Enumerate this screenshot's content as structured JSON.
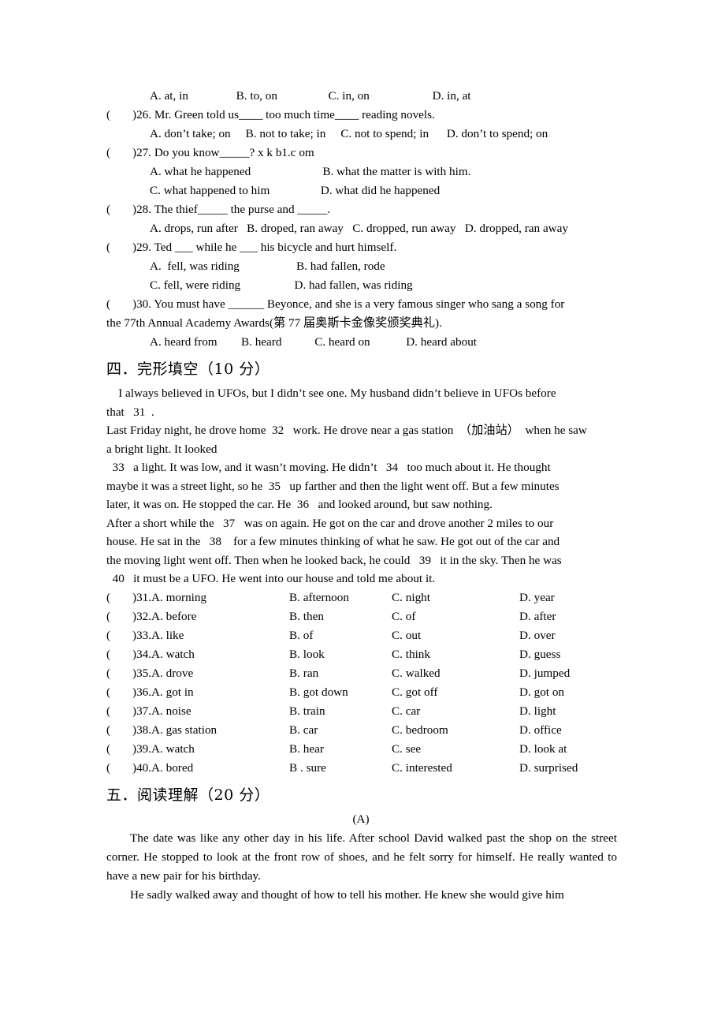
{
  "document": {
    "kind": "english-exam-paper-page"
  },
  "grammar_section": {
    "q25_options_line": "A. at, in                B. to, on                 C. in, on                     D. in, at",
    "questions": [
      {
        "marker_open": "(",
        "marker_close": ")",
        "stem": "26. Mr. Green told us____ too much time____ reading novels.",
        "options_lines": [
          "A. don’t take; on     B. not to take; in     C. not to spend; in      D. don’t to spend; on"
        ]
      },
      {
        "marker_open": "(",
        "marker_close": ")",
        "stem": "27. Do you know_____? x k b1.c om",
        "options_lines": [
          "A. what he happened                        B. what the matter is with him.",
          "C. what happened to him                 D. what did he happened"
        ]
      },
      {
        "marker_open": "(",
        "marker_close": ")",
        "stem": "28. The thief_____ the purse and _____.",
        "options_lines": [
          "A. drops, run after   B. droped, ran away   C. dropped, run away   D. dropped, ran away"
        ]
      },
      {
        "marker_open": "(",
        "marker_close": ")",
        "stem": "29. Ted ___ while he ___ his bicycle and hurt himself.",
        "options_lines": [
          "A.  fell, was riding                   B. had fallen, rode",
          "C. fell, were riding                  D. had fallen, was riding"
        ]
      },
      {
        "marker_open": "(",
        "marker_close": ")",
        "stem_line1": "30. You must have ______ Beyonce, and she is a very famous singer who sang a song for",
        "stem_line2": "the 77th Annual Academy Awards(第 77 届奥斯卡金像奖颁奖典礼).",
        "options_lines": [
          "A. heard from        B. heard           C. heard on            D. heard about"
        ]
      }
    ]
  },
  "cloze_section": {
    "heading": "四．完形填空（10 分）",
    "passage_lines": [
      "    I always believed in UFOs, but I didn’t see one. My husband didn’t believe in UFOs before",
      "that   31  .",
      "Last Friday night, he drove home  32   work. He drove near a gas station  （加油站）  when he saw",
      "a bright light. It looked",
      "  33   a light. It was low, and it wasn’t moving. He didn’t   34   too much about it. He thought",
      "maybe it was a street light, so he  35   up farther and then the light went off. But a few minutes",
      "later, it was on. He stopped the car. He  36   and looked around, but saw nothing.",
      "After a short while the   37   was on again. He got on the car and drove another 2 miles to our",
      "house. He sat in the   38    for a few minutes thinking of what he saw. He got out of the car and",
      "the moving light went off. Then when he looked back, he could   39   it in the sky. Then he was",
      "  40   it must be a UFO. He went into our house and told me about it."
    ],
    "option_rows": [
      {
        "number": "31.",
        "a": "A. morning",
        "b": "B. afternoon",
        "c": "C. night",
        "d": "D. year"
      },
      {
        "number": "32.",
        "a": "A. before",
        "b": "B. then",
        "c": "C. of",
        "d": "D. after"
      },
      {
        "number": "33.",
        "a": "A. like",
        "b": "B. of",
        "c": "C. out",
        "d": "D. over"
      },
      {
        "number": "34.",
        "a": "A. watch",
        "b": "B. look",
        "c": "C. think",
        "d": "D. guess"
      },
      {
        "number": "35.",
        "a": "A. drove",
        "b": "B. ran",
        "c": "C. walked",
        "d": "D. jumped"
      },
      {
        "number": "36.",
        "a": "A. got in",
        "b": "B. got down",
        "c": "C. got off",
        "d": "D. got on"
      },
      {
        "number": "37.",
        "a": "A. noise",
        "b": "B. train",
        "c": "C. car",
        "d": "D. light"
      },
      {
        "number": "38.",
        "a": "A. gas station",
        "b": "B. car",
        "c": "C. bedroom",
        "d": "D. office"
      },
      {
        "number": "39.",
        "a": "A. watch",
        "b": "B. hear",
        "c": "C. see",
        "d": "D. look at"
      },
      {
        "number": "40.",
        "a": "A. bored",
        "b": "B . sure",
        "c": "C. interested",
        "d": "D. surprised"
      }
    ],
    "marker_open": "(",
    "marker_close": ")"
  },
  "reading_section": {
    "heading": "五．阅读理解（20 分）",
    "passage_label": "(A)",
    "paragraphs": [
      "The date was like any other day in his life. After school David walked past the shop on the street corner. He stopped to look at the front row of shoes, and he felt sorry for himself. He really wanted to have a new pair for his birthday.",
      "He sadly walked away and thought of how to tell his mother. He knew she would give him"
    ]
  }
}
